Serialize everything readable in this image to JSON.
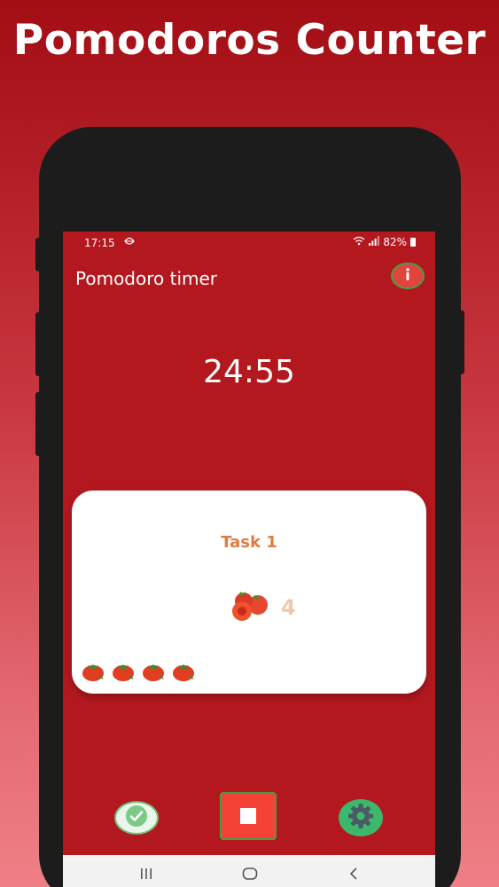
{
  "banner": {
    "title": "Pomodoros Counter"
  },
  "status_bar": {
    "time": "17:15",
    "battery": "82%"
  },
  "app": {
    "title": "Pomodoro timer"
  },
  "timer": {
    "value": "24:55"
  },
  "task": {
    "name": "Task 1",
    "pomodoro_count": "4",
    "completed_tomatoes": 4
  },
  "colors": {
    "app_background": "#b3181f",
    "task_title": "#e07b43",
    "stop_button": "#f44336",
    "settings_button": "#3bb86b",
    "accent_border": "#43a047"
  },
  "icons": {
    "info": "info-icon",
    "done": "checkmark-icon",
    "stop": "stop-icon",
    "settings": "gear-icon",
    "tomato": "tomato-icon",
    "nav_recents": "recents-icon",
    "nav_home": "home-icon",
    "nav_back": "back-icon"
  }
}
